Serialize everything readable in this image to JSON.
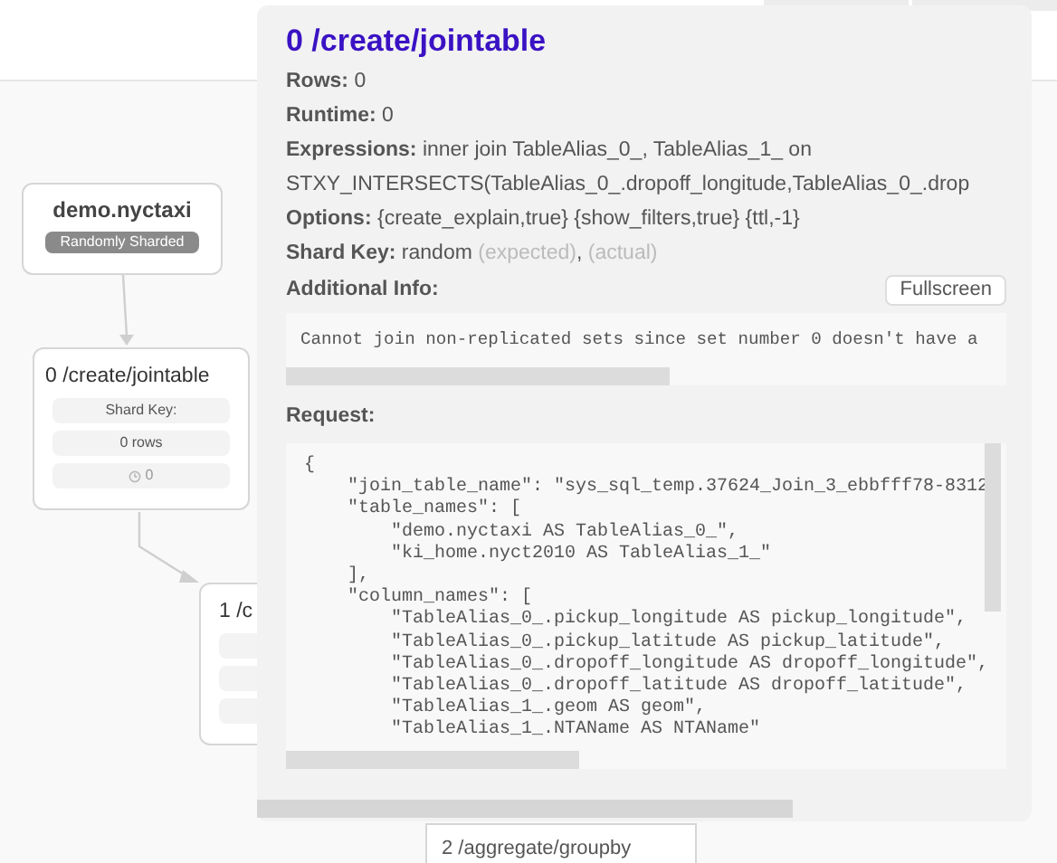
{
  "graph": {
    "nodes": [
      {
        "kind": "table",
        "title": "demo.nyctaxi",
        "badge": "Randomly Sharded"
      },
      {
        "kind": "step",
        "title": "0 /create/jointable",
        "rows": [
          "Shard Key:",
          "0 rows"
        ],
        "time": "0"
      },
      {
        "kind": "partial",
        "title": "1 /c"
      },
      {
        "kind": "footer",
        "title": "2 /aggregate/groupby"
      }
    ]
  },
  "popup": {
    "title": "0 /create/jointable",
    "fields": [
      {
        "label": "Rows:",
        "value": [
          {
            "text": "0",
            "muted": false
          }
        ]
      },
      {
        "label": "Runtime:",
        "value": [
          {
            "text": "0",
            "muted": false
          }
        ]
      },
      {
        "label": "Expressions:",
        "value": [
          {
            "text": "inner join TableAlias_0_, TableAlias_1_ on",
            "muted": false
          }
        ],
        "continuation": "STXY_INTERSECTS(TableAlias_0_.dropoff_longitude,TableAlias_0_.drop"
      },
      {
        "label": "Options:",
        "value": [
          {
            "text": "{create_explain,true} {show_filters,true} {ttl,-1}",
            "muted": false
          }
        ]
      },
      {
        "label": "Shard Key:",
        "value": [
          {
            "text": "random",
            "muted": false
          },
          {
            "text": "(expected)",
            "muted": true
          },
          {
            "text": "(actual)",
            "muted": true
          }
        ],
        "separator": ","
      }
    ],
    "additional_info": {
      "label": "Additional Info:",
      "button": "Fullscreen",
      "text": "Cannot join non-replicated sets since set number 0 doesn't have a"
    },
    "request": {
      "label": "Request:",
      "lines": [
        "{",
        "    \"join_table_name\": \"sys_sql_temp.37624_Join_3_ebbfff78-8312",
        "    \"table_names\": [",
        "        \"demo.nyctaxi AS TableAlias_0_\",",
        "        \"ki_home.nyct2010 AS TableAlias_1_\"",
        "    ],",
        "    \"column_names\": [",
        "        \"TableAlias_0_.pickup_longitude AS pickup_longitude\",",
        "        \"TableAlias_0_.pickup_latitude AS pickup_latitude\",",
        "        \"TableAlias_0_.dropoff_longitude AS dropoff_longitude\",",
        "        \"TableAlias_0_.dropoff_latitude AS dropoff_latitude\",",
        "        \"TableAlias_1_.geom AS geom\",",
        "        \"TableAlias_1_.NTAName AS NTAName\""
      ]
    }
  }
}
